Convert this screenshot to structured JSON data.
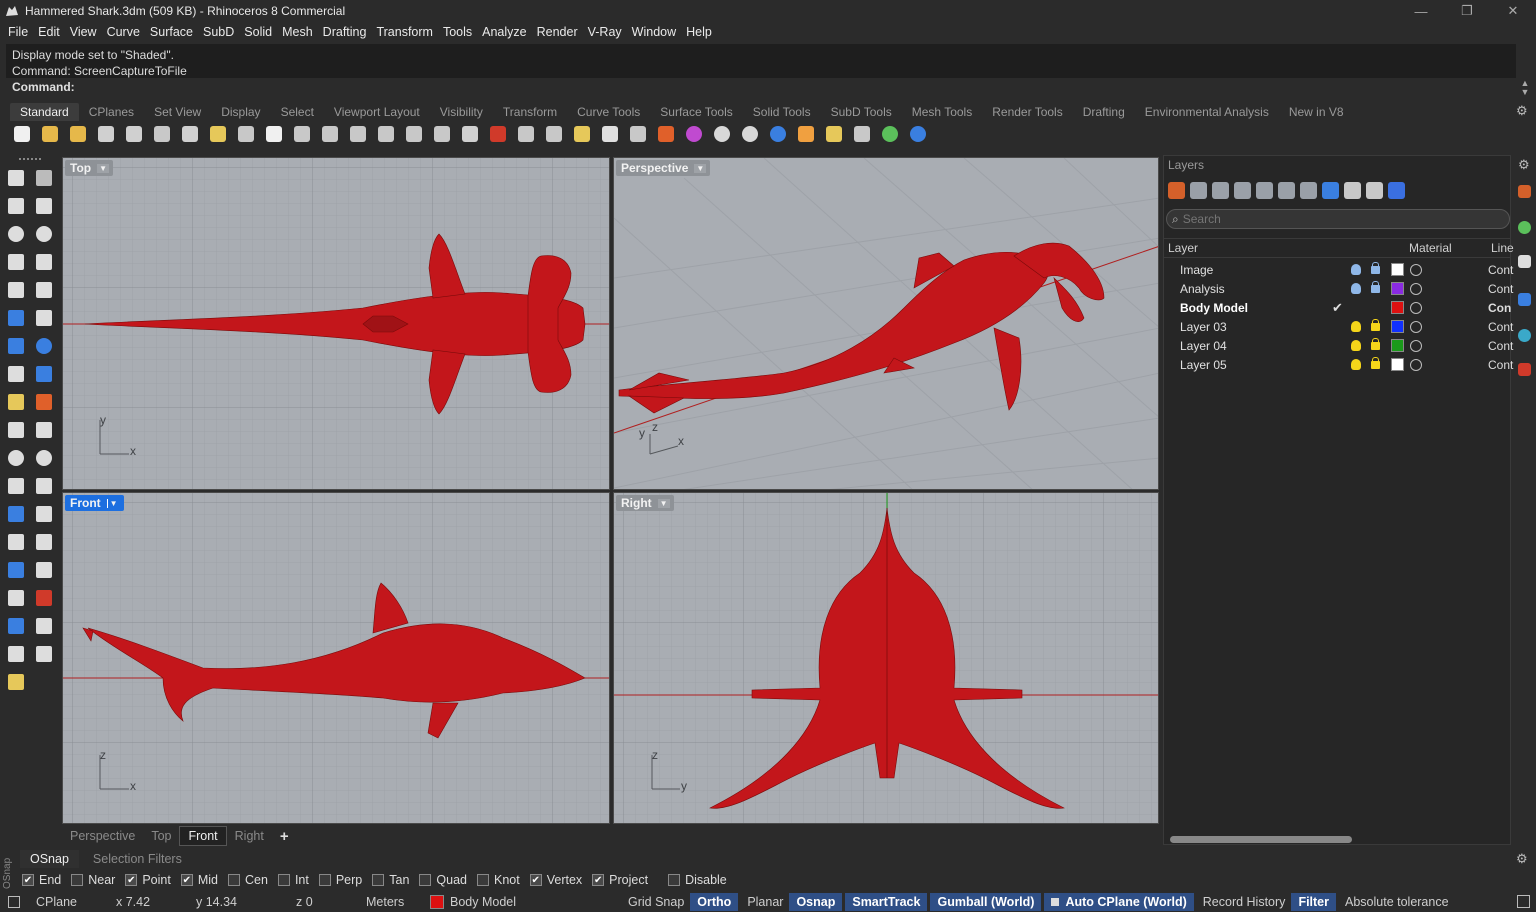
{
  "window": {
    "title": "Hammered Shark.3dm (509 KB) - Rhinoceros 8 Commercial",
    "buttons": [
      "—",
      "❐",
      "✕"
    ]
  },
  "menu": [
    "File",
    "Edit",
    "View",
    "Curve",
    "Surface",
    "SubD",
    "Solid",
    "Mesh",
    "Drafting",
    "Transform",
    "Tools",
    "Analyze",
    "Render",
    "V-Ray",
    "Window",
    "Help"
  ],
  "command": {
    "history": [
      "Display mode set to \"Shaded\".",
      "Command: ScreenCaptureToFile"
    ],
    "prompt": "Command:"
  },
  "toolbar_tabs": [
    "Standard",
    "CPlanes",
    "Set View",
    "Display",
    "Select",
    "Viewport Layout",
    "Visibility",
    "Transform",
    "Curve Tools",
    "Surface Tools",
    "Solid Tools",
    "SubD Tools",
    "Mesh Tools",
    "Render Tools",
    "Drafting",
    "Environmental Analysis",
    "New in V8"
  ],
  "toolbar_icons": [
    "new-icon",
    "open-icon",
    "save-icon",
    "print-icon",
    "import-icon",
    "cut-icon",
    "copy-icon",
    "paste-icon",
    "undo-icon",
    "pan-icon",
    "rotate-view-icon",
    "zoom-icon",
    "zoom-window-icon",
    "zoom-extents-icon",
    "zoom-selected-icon",
    "rotate-icon",
    "four-views-icon",
    "car-icon",
    "cplane-icon",
    "point-icon",
    "select-points-icon",
    "light-icon",
    "lock-icon",
    "layer-icon",
    "color-wheel-icon",
    "shaded-sphere-icon",
    "grid-sphere-icon",
    "render-sphere-icon",
    "material-icon",
    "sun-icon",
    "dimension-icon",
    "environment-icon",
    "help-icon"
  ],
  "viewports": {
    "top": {
      "label": "Top",
      "axes": [
        "y",
        "x"
      ]
    },
    "perspective": {
      "label": "Perspective",
      "axes": [
        "y",
        "z",
        "x"
      ]
    },
    "front": {
      "label": "Front",
      "axes": [
        "z",
        "x"
      ]
    },
    "right": {
      "label": "Right",
      "axes": [
        "z",
        "y"
      ]
    }
  },
  "viewport_tabs": [
    "Perspective",
    "Top",
    "Front",
    "Right",
    "+"
  ],
  "layers_panel": {
    "title": "Layers",
    "search_placeholder": "Search",
    "columns": {
      "layer": "Layer",
      "material": "Material",
      "linetype": "Line"
    },
    "rows": [
      {
        "name": "Image",
        "color": "#ffffff",
        "bulb": "#8fb7e8",
        "lock": "#8fb7e8",
        "current": false,
        "linetype": "Cont"
      },
      {
        "name": "Analysis",
        "color": "#8a2be2",
        "bulb": "#8fb7e8",
        "lock": "#8fb7e8",
        "current": false,
        "linetype": "Cont"
      },
      {
        "name": "Body Model",
        "color": "#dd1111",
        "bulb": "",
        "lock": "",
        "current": true,
        "linetype": "Con"
      },
      {
        "name": "Layer 03",
        "color": "#1030ff",
        "bulb": "#f5d51a",
        "lock": "#f5d51a",
        "current": false,
        "linetype": "Cont"
      },
      {
        "name": "Layer 04",
        "color": "#1a9a1a",
        "bulb": "#f5d51a",
        "lock": "#f5d51a",
        "current": false,
        "linetype": "Cont"
      },
      {
        "name": "Layer 05",
        "color": "#ffffff",
        "bulb": "#f5d51a",
        "lock": "#f5d51a",
        "current": false,
        "linetype": "Cont"
      }
    ]
  },
  "osnap": {
    "tabs": [
      "OSnap",
      "Selection Filters"
    ],
    "side_label": "OSnap",
    "snaps": [
      {
        "label": "End",
        "on": true
      },
      {
        "label": "Near",
        "on": false
      },
      {
        "label": "Point",
        "on": true
      },
      {
        "label": "Mid",
        "on": true
      },
      {
        "label": "Cen",
        "on": false
      },
      {
        "label": "Int",
        "on": false
      },
      {
        "label": "Perp",
        "on": false
      },
      {
        "label": "Tan",
        "on": false
      },
      {
        "label": "Quad",
        "on": false
      },
      {
        "label": "Knot",
        "on": false
      },
      {
        "label": "Vertex",
        "on": true
      },
      {
        "label": "Project",
        "on": true
      },
      {
        "label": "Disable",
        "on": false
      }
    ]
  },
  "status": {
    "cplane": "CPlane",
    "x": "x 7.42",
    "y": "y 14.34",
    "z": "z 0",
    "units": "Meters",
    "layer": "Body Model",
    "layer_color": "#dd1111",
    "grid_snap": "Grid Snap",
    "ortho": "Ortho",
    "planar": "Planar",
    "osnap": "Osnap",
    "smarttrack": "SmartTrack",
    "gumball": "Gumball (World)",
    "auto_cplane": "Auto CPlane (World)",
    "record_history": "Record History",
    "filter": "Filter",
    "tolerance": "Absolute tolerance"
  },
  "colors": {
    "model": "#c3161b",
    "viewport_bg": "#a9adb3",
    "active_view": "#1d6fe0"
  }
}
